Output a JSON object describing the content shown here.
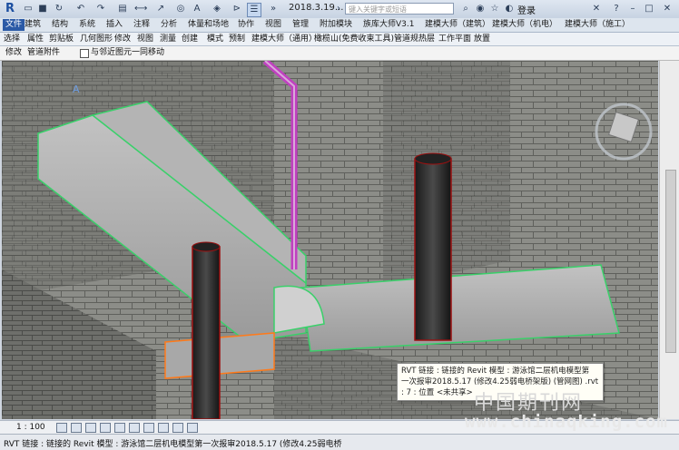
{
  "qat": {
    "file_name": "2018.3.19...",
    "search_placeholder": "键入关键字或短语",
    "login": "登录"
  },
  "tabs": [
    "文件",
    "建筑",
    "结构",
    "系统",
    "插入",
    "注释",
    "分析",
    "体量和场地",
    "协作",
    "视图",
    "管理",
    "附加模块",
    "族库大师V3.1",
    "建模大师（建筑）",
    "建模大师（机电）",
    "建模大师（施工）"
  ],
  "ribbon": [
    "选择",
    "属性",
    "剪贴板",
    "几何图形",
    "修改",
    "视图",
    "测量",
    "创建",
    "模式",
    "预制",
    "建模大师（通用）",
    "橄榄山(免费收束工具)",
    "管道规热层",
    "工作平面",
    "放置"
  ],
  "options": {
    "modify": "修改",
    "pipe_fittings": "管道附件",
    "move_with_nearby": "与邻近图元一同移动"
  },
  "tooltip": {
    "line1": "RVT 链接 : 链接的 Revit 模型 : 游泳馆二层机电模型第",
    "line2": "一次报审2018.5.17 (修改4.25弱电桥架版) (管网图) .rvt",
    "line3": ": 7 : 位置 <未共享>"
  },
  "view_control": {
    "scale": "1 : 100"
  },
  "status_bar": {
    "text": "RVT 链接 : 链接的 Revit 模型 : 游泳馆二层机电模型第一次报审2018.5.17 (修改4.25弱电桥"
  },
  "watermark": {
    "cn": "中国期刊网",
    "url": "www.chinaqking.com"
  },
  "colors": {
    "accent": "#2b5aa6",
    "duct_edge": "#3ad06a",
    "pipe_edge": "#c040c0",
    "selection": "#ff7a1a"
  }
}
